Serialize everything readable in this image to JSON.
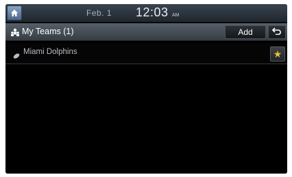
{
  "status_bar": {
    "home_icon": "home-icon",
    "date": "Feb.  1",
    "time": "12:03",
    "ampm": "AM"
  },
  "title_bar": {
    "group_icon": "people-icon",
    "title": "My Teams (1)",
    "add_label": "Add",
    "back_icon": "back-arrow-icon"
  },
  "teams": [
    {
      "icon": "football-icon",
      "name": "Miami Dolphins",
      "favorite": true,
      "favorite_icon": "star-icon"
    }
  ],
  "colors": {
    "star": "#e8c233",
    "home_button": "#6c88aa",
    "title_bar": "#4a535c"
  }
}
